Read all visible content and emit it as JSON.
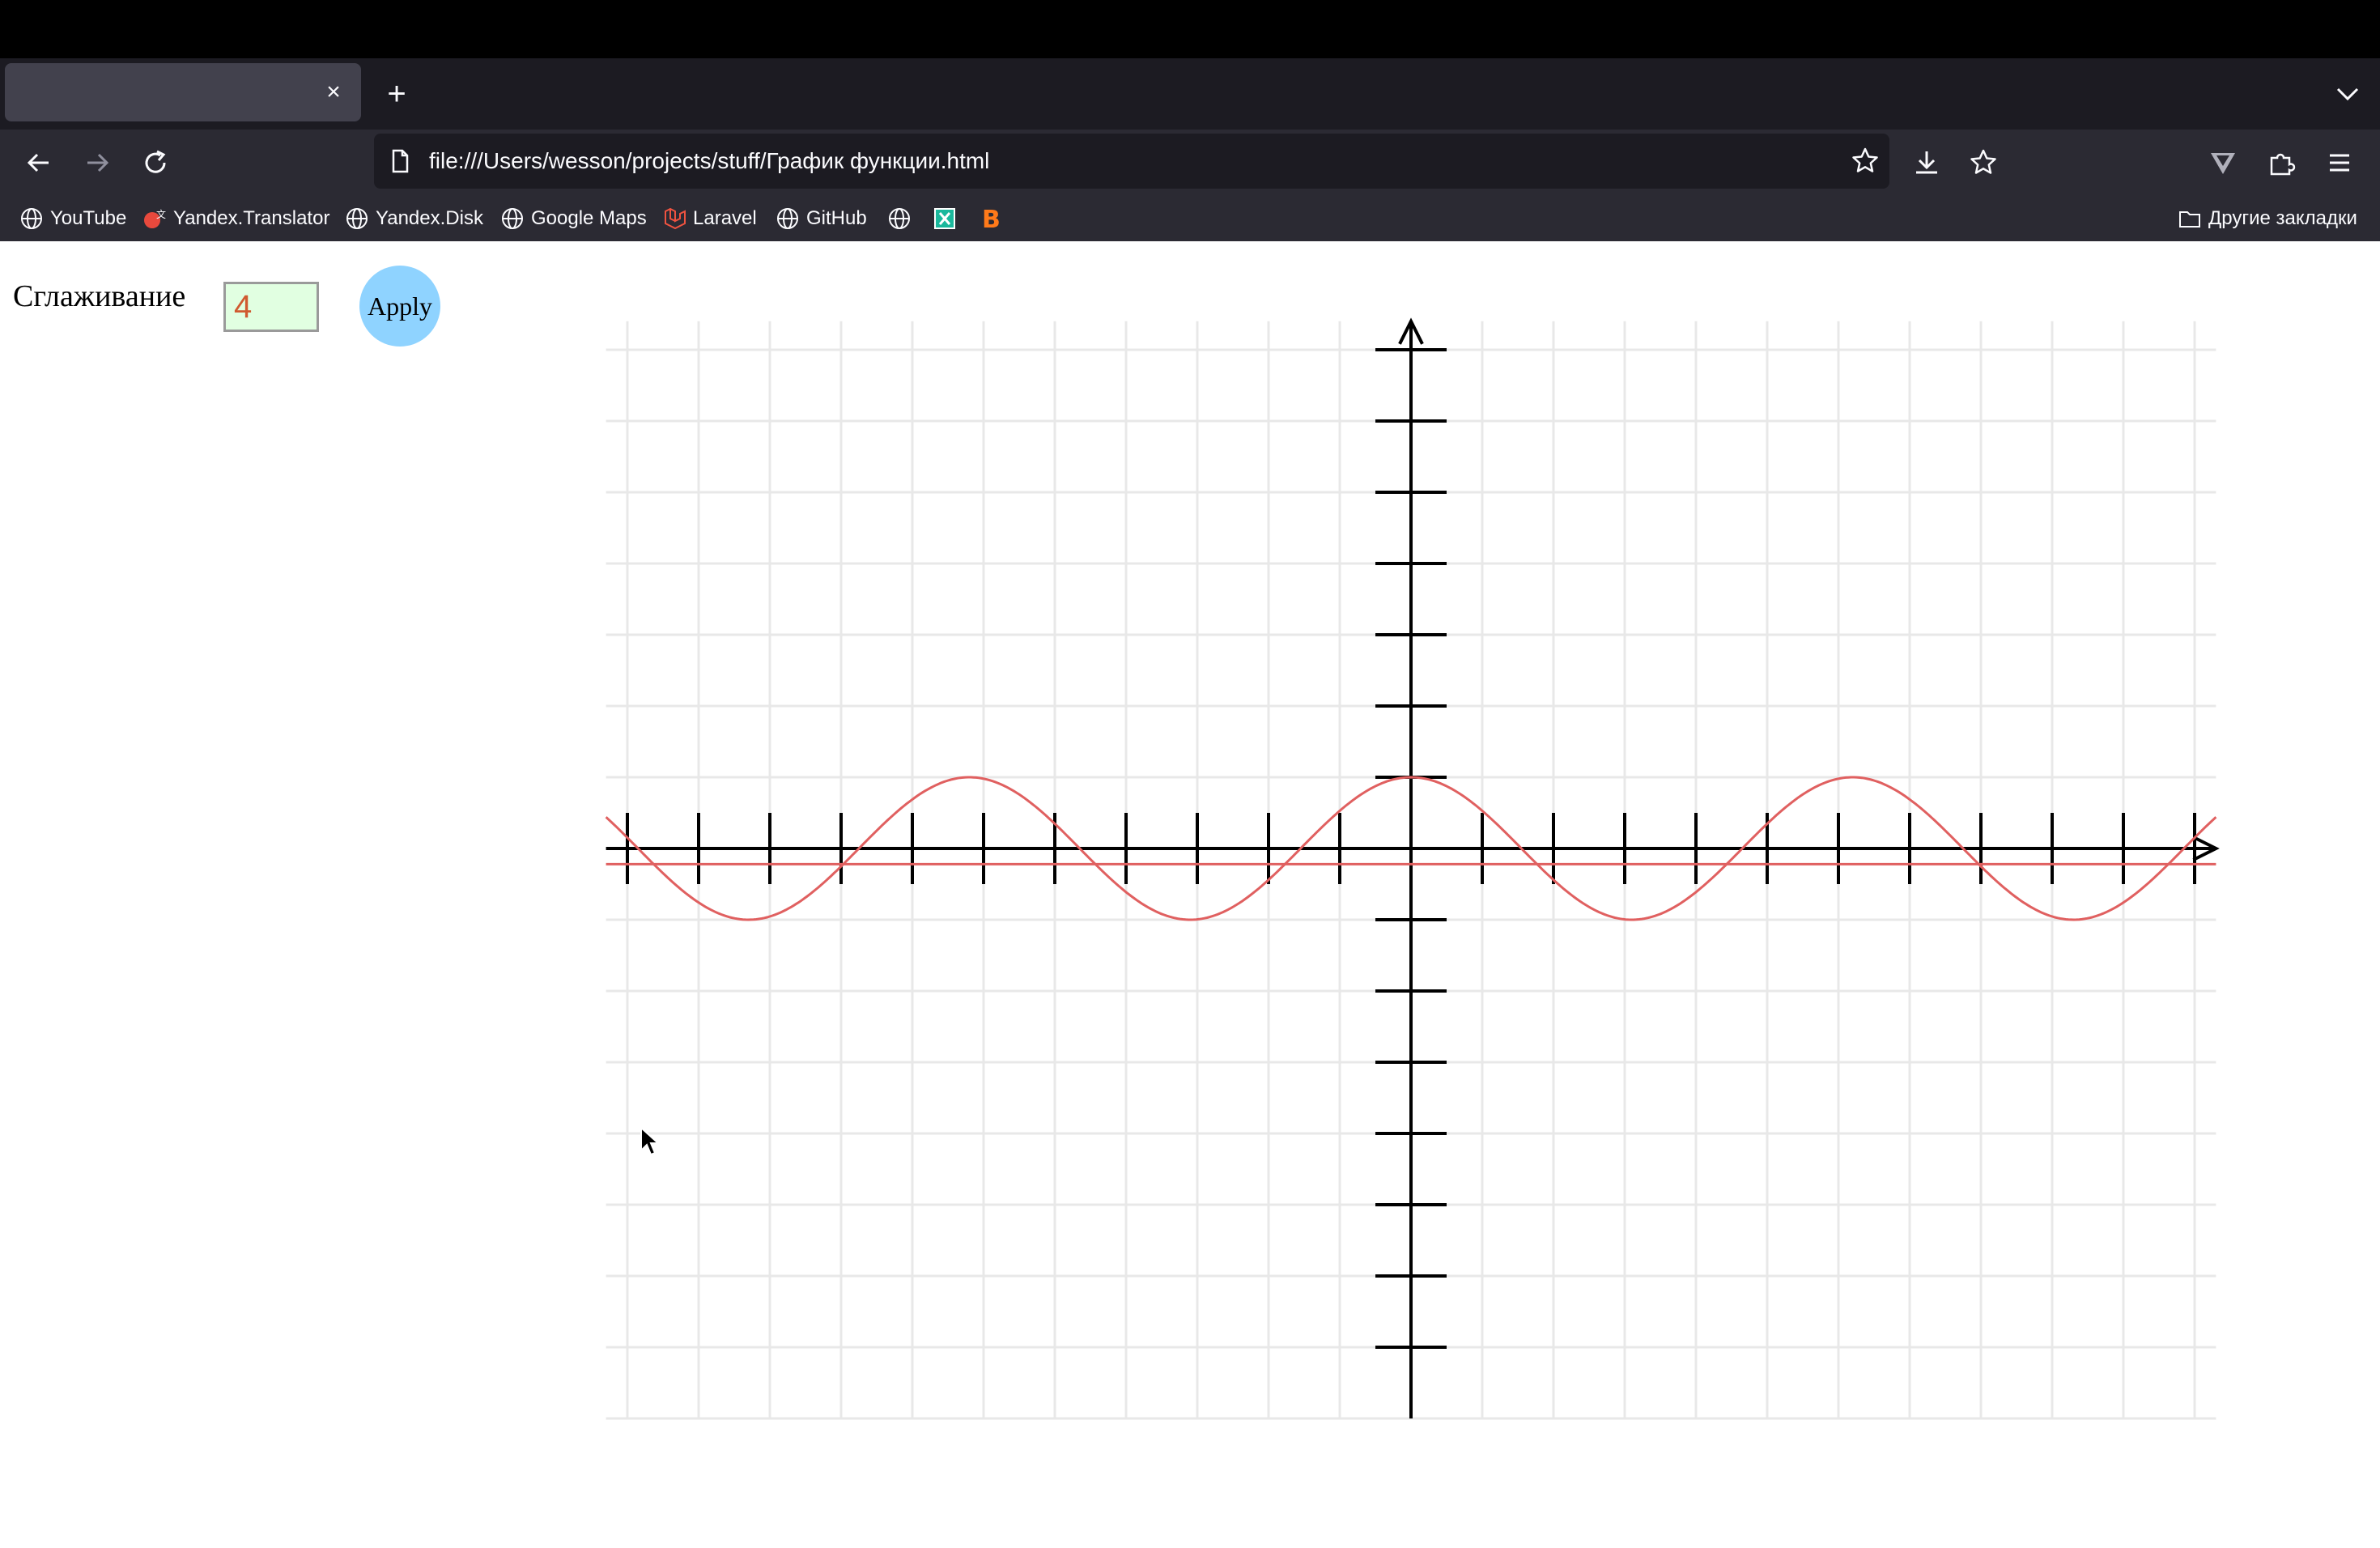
{
  "browser": {
    "tab": {
      "title": "",
      "close_glyph": "×"
    },
    "new_tab_glyph": "+",
    "url": "file:///Users/wesson/projects/stuff/График функции.html",
    "bookmarks": [
      {
        "label": "YouTube",
        "icon": "globe-icon"
      },
      {
        "label": "Yandex.Translator",
        "icon": "yandex-translate-icon"
      },
      {
        "label": "Yandex.Disk",
        "icon": "globe-icon"
      },
      {
        "label": "Google Maps",
        "icon": "globe-icon"
      },
      {
        "label": "Laravel",
        "icon": "laravel-icon"
      },
      {
        "label": "GitHub",
        "icon": "globe-icon"
      },
      {
        "label": "",
        "icon": "globe-icon"
      },
      {
        "label": "",
        "icon": "x-icon"
      },
      {
        "label": "",
        "icon": "b-icon"
      }
    ],
    "other_bookmarks": "Другие закладки"
  },
  "page": {
    "smoothing_label": "Сглаживание",
    "smoothing_value": "4",
    "apply_label": "Apply"
  },
  "colors": {
    "curve": "#e06060",
    "axis": "#000000",
    "grid": "#e8e8e8",
    "apply_button": "#8fd3ff",
    "input_background": "#e1ffe1"
  },
  "chart_data": {
    "type": "line",
    "title": "",
    "xlabel": "",
    "ylabel": "",
    "xlim": [
      -11.3,
      11.3
    ],
    "ylim": [
      -8,
      7.4
    ],
    "x_ticks": [
      -11,
      -10,
      -9,
      -8,
      -7,
      -6,
      -5,
      -4,
      -3,
      -2,
      -1,
      1,
      2,
      3,
      4,
      5,
      6,
      7,
      8,
      9,
      10,
      11
    ],
    "y_ticks": [
      -7,
      -6,
      -5,
      -4,
      -3,
      -2,
      -1,
      1,
      2,
      3,
      4,
      5,
      6,
      7
    ],
    "grid": true,
    "series": [
      {
        "kind": "horizontal_line",
        "y": -0.22
      },
      {
        "kind": "function",
        "description": "cosine curve",
        "x": [
          -11.3,
          -11,
          -10.5,
          -10,
          -9.5,
          -9,
          -8.5,
          -8,
          -7.5,
          -7,
          -6.5,
          -6,
          -5.5,
          -5,
          -4.5,
          -4,
          -3.5,
          -3,
          -2.5,
          -2,
          -1.5,
          -1,
          -0.5,
          0,
          0.5,
          1,
          1.5,
          2,
          2.5,
          3,
          3.5,
          4,
          4.5,
          5,
          4.5,
          6,
          6.5,
          7,
          7.5,
          8,
          8.5,
          9,
          9.5,
          10,
          10.5,
          11,
          11.3
        ]
      }
    ]
  }
}
